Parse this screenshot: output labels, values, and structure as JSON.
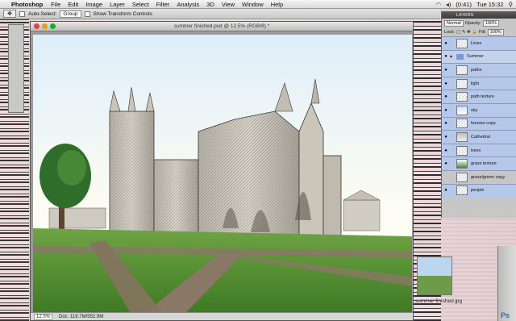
{
  "menubar": {
    "app": "Photoshop",
    "menus": [
      "File",
      "Edit",
      "Image",
      "Layer",
      "Select",
      "Filter",
      "Analysis",
      "3D",
      "View",
      "Window",
      "Help"
    ],
    "battery": "(0:41)",
    "clock": "Tue 15:32"
  },
  "options": {
    "auto_select": "Auto-Select:",
    "group_value": "Group",
    "transform": "Show Transform Controls"
  },
  "document": {
    "title": "summer finished.psd @ 12.5% (RGB/8) *",
    "zoom": "12.5%",
    "doc_size": "Doc: 119.7M/552.9M"
  },
  "layers_panel": {
    "title": "LAYERS",
    "blend_mode": "Normal",
    "opacity_label": "Opacity:",
    "opacity_value": "100%",
    "lock_label": "Lock:",
    "fill_label": "Fill:",
    "fill_value": "100%",
    "layers": [
      {
        "name": "Lines",
        "visible": true,
        "kind": "layer",
        "thumb": "lines"
      },
      {
        "name": "Summer",
        "visible": true,
        "kind": "group",
        "thumb": "folder"
      },
      {
        "name": "paths",
        "visible": true,
        "kind": "layer",
        "thumb": "check"
      },
      {
        "name": "light",
        "visible": true,
        "kind": "layer",
        "thumb": "check"
      },
      {
        "name": "path texture",
        "visible": true,
        "kind": "layer",
        "thumb": "check"
      },
      {
        "name": "sky",
        "visible": true,
        "kind": "layer",
        "thumb": "sky"
      },
      {
        "name": "houses copy",
        "visible": true,
        "kind": "layer",
        "thumb": "check"
      },
      {
        "name": "Cathedral",
        "visible": true,
        "kind": "layer",
        "thumb": "cath"
      },
      {
        "name": "trees",
        "visible": true,
        "kind": "layer",
        "thumb": "check"
      },
      {
        "name": "grass texture",
        "visible": true,
        "kind": "layer",
        "thumb": "grass"
      },
      {
        "name": "grass/green copy",
        "visible": false,
        "kind": "layer",
        "thumb": "check"
      },
      {
        "name": "people",
        "visible": true,
        "kind": "layer",
        "thumb": "check"
      }
    ]
  },
  "desktop": {
    "file_label": "summer finished.jpg",
    "ps_badge": "Ps"
  },
  "colors": {
    "layer_selected": "#b6c8ea",
    "grass": "#4f8a2e",
    "path": "#8a7867",
    "sky_top": "#dfeefa"
  }
}
